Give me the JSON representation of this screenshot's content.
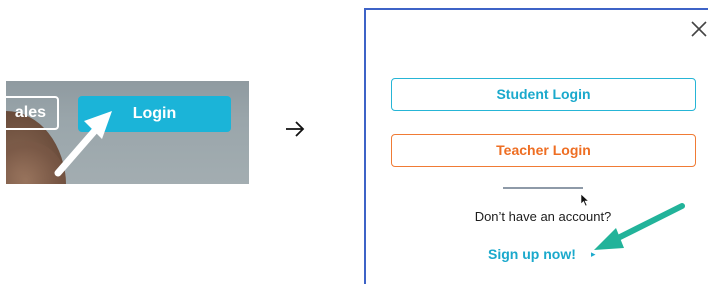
{
  "left_crop": {
    "ghost_button_label": "ales",
    "login_button_label": "Login"
  },
  "transition_arrow": "→",
  "dialog": {
    "student_login_label": "Student Login",
    "teacher_login_label": "Teacher Login",
    "no_account_text": "Don’t have an account?",
    "signup_label": "Sign up now!",
    "signup_caret": "▸"
  },
  "colors": {
    "login_fill": "#1bb4d8",
    "student_accent": "#26b5d6",
    "teacher_accent": "#f07b35",
    "dialog_border": "#3e63c7",
    "annotation_arrow": "#22b39a"
  },
  "icons": [
    "close-icon",
    "cursor-icon",
    "arrow-right-icon",
    "pointer-annotation-arrow-icon"
  ]
}
